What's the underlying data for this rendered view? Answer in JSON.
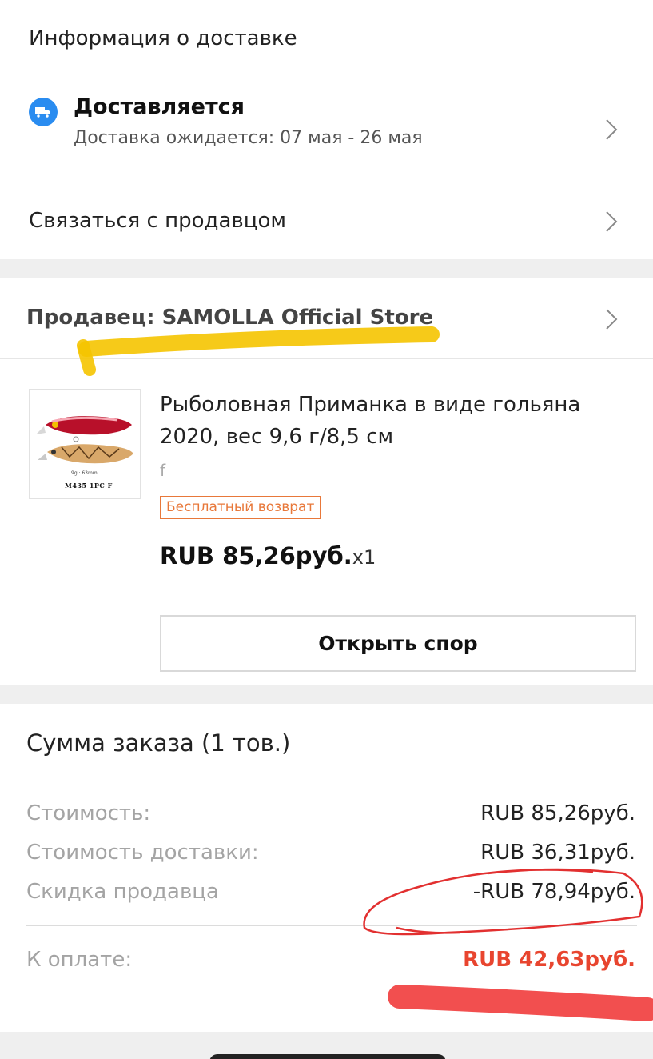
{
  "delivery": {
    "section_title": "Информация о доставке",
    "status_icon": "delivery-truck-icon",
    "status": "Доставляется",
    "expected": "Доставка ожидается: 07 мая - 26 мая",
    "contact_label": "Связаться с продавцом"
  },
  "seller": {
    "label": "Продавец: SAMOLLA Official Store"
  },
  "product": {
    "image_caption_top": "9g · 63mm",
    "image_caption_bottom": "M435  1PC  F",
    "title": "Рыболовная Приманка в виде гольяна 2020, вес 9,6 г/8,5 см",
    "variant": "f",
    "badge": "Бесплатный возврат",
    "price": "RUB 85,26руб.",
    "quantity": "x1",
    "dispute_button": "Открыть спор"
  },
  "summary": {
    "title": "Сумма заказа (1 тов.)",
    "rows": [
      {
        "label": "Стоимость:",
        "value": "RUB 85,26руб."
      },
      {
        "label": "Стоимость доставки:",
        "value": "RUB 36,31руб."
      },
      {
        "label": "Скидка продавца",
        "value": "-RUB 78,94руб."
      }
    ],
    "total_label": "К оплате:",
    "total_value": "RUB 42,63руб."
  },
  "colors": {
    "accent_blue": "#2a8cf0",
    "badge_orange": "#e8783a",
    "total_red": "#e8452f",
    "highlight_yellow": "#f5c400",
    "marker_red": "#f03030"
  }
}
